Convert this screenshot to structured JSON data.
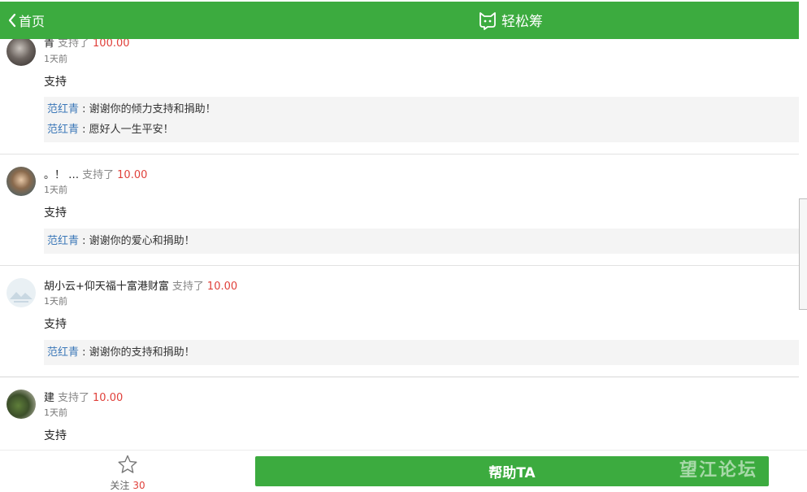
{
  "header": {
    "back_label": "首页",
    "brand_name": "轻松筹"
  },
  "comments": [
    {
      "name": "青",
      "verb": "支持了",
      "amount": "100.00",
      "time": "1天前",
      "message": "支持",
      "replies": [
        {
          "name": "范红青",
          "sep": " : ",
          "text": "谢谢你的倾力支持和捐助！"
        },
        {
          "name": "范红青",
          "sep": " : ",
          "text": "愿好人一生平安！"
        }
      ]
    },
    {
      "name": "。！ …",
      "verb": "支持了",
      "amount": "10.00",
      "time": "1天前",
      "message": "支持",
      "replies": [
        {
          "name": "范红青",
          "sep": " : ",
          "text": "谢谢你的爱心和捐助！"
        }
      ]
    },
    {
      "name": "胡小云+仰天福十富港财富",
      "verb": "支持了",
      "amount": "10.00",
      "time": "1天前",
      "message": "支持",
      "replies": [
        {
          "name": "范红青",
          "sep": " : ",
          "text": "谢谢你的支持和捐助！"
        }
      ]
    },
    {
      "name": "建",
      "verb": "支持了",
      "amount": "10.00",
      "time": "1天前",
      "message": "支持",
      "replies": []
    }
  ],
  "bottom": {
    "follow_label": "关注",
    "follow_count": "30",
    "help_label": "帮助TA"
  },
  "icons": {
    "back": "chevron-left-icon",
    "brand": "cat-logo-icon",
    "follow": "star-outline-icon"
  },
  "colors": {
    "accent": "#3cab3f",
    "amount": "#e0413b",
    "reply_name": "#3c78b8"
  },
  "watermark": "望江论坛"
}
